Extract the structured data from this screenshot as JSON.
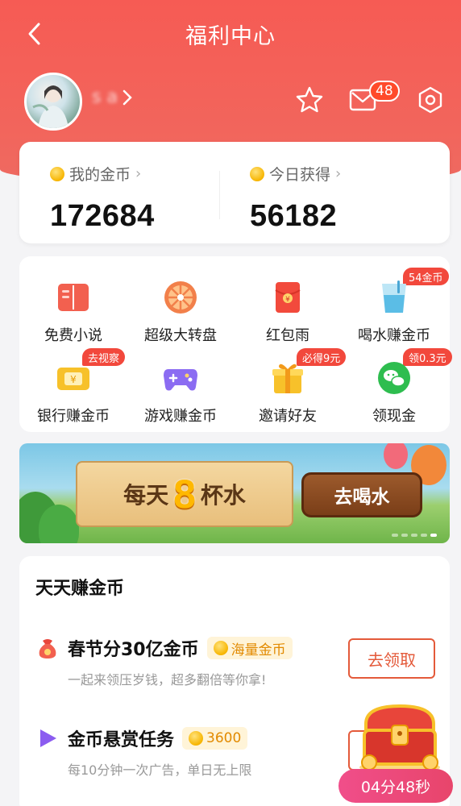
{
  "header": {
    "title": "福利中心"
  },
  "profile": {
    "username": "s a"
  },
  "notifications": {
    "count": "48"
  },
  "coins": {
    "my_coins_label": "我的金币",
    "my_coins_value": "172684",
    "today_label": "今日获得",
    "today_value": "56182"
  },
  "grid": {
    "items": [
      {
        "label": "免费小说",
        "icon": "book-icon"
      },
      {
        "label": "超级大转盘",
        "icon": "wheel-icon"
      },
      {
        "label": "红包雨",
        "icon": "red-envelope-icon"
      },
      {
        "label": "喝水赚金币",
        "icon": "water-cup-icon",
        "tag": "54金币"
      },
      {
        "label": "银行赚金币",
        "icon": "bank-card-icon",
        "tag": "去视察"
      },
      {
        "label": "游戏赚金币",
        "icon": "gamepad-icon"
      },
      {
        "label": "邀请好友",
        "icon": "gift-icon",
        "tag": "必得9元"
      },
      {
        "label": "领现金",
        "icon": "wechat-icon",
        "tag": "领0.3元"
      }
    ]
  },
  "banner": {
    "text_left": "每天",
    "number": "8",
    "text_right": "杯水",
    "button": "去喝水"
  },
  "tasks": {
    "section_title": "天天赚金币",
    "items": [
      {
        "title": "春节分30亿金币",
        "pill": "海量金币",
        "desc": "一起来领压岁钱，超多翻倍等你拿!",
        "button": "去领取",
        "icon": "money-bag-icon"
      },
      {
        "title": "金币悬赏任务",
        "pill": "3600",
        "desc": "每10分钟一次广告，单日无上限",
        "icon": "play-icon"
      }
    ]
  },
  "timer": {
    "text": "04分48秒"
  },
  "colors": {
    "header_red": "#f65b54",
    "accent_orange": "#e45a3a",
    "coin_gold": "#f7b500"
  }
}
